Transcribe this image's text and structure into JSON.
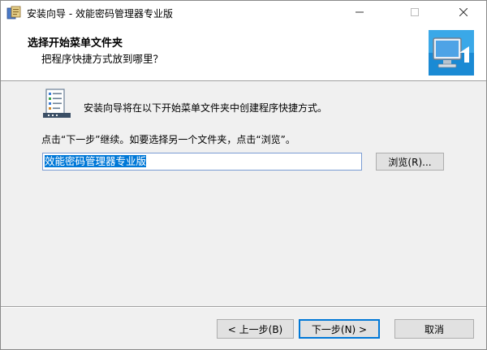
{
  "window": {
    "title": "安装向导 - 效能密码管理器专业版",
    "controls": {
      "minimize": "—",
      "maximize": "☐",
      "close": "✕"
    }
  },
  "header": {
    "title": "选择开始菜单文件夹",
    "subtitle": "把程序快捷方式放到哪里？"
  },
  "main": {
    "description": "安装向导将在以下开始菜单文件夹中创建程序快捷方式。",
    "instruction": "点击“下一步”继续。如要选择另一个文件夹，点击“浏览”。",
    "folder_value": "效能密码管理器专业版",
    "browse_label": "浏览(R)..."
  },
  "footer": {
    "back_label": "< 上一步(B)",
    "next_label": "下一步(N) >",
    "cancel_label": "取消"
  },
  "colors": {
    "selection": "#0078d7",
    "default_button_border": "#0078d7"
  }
}
